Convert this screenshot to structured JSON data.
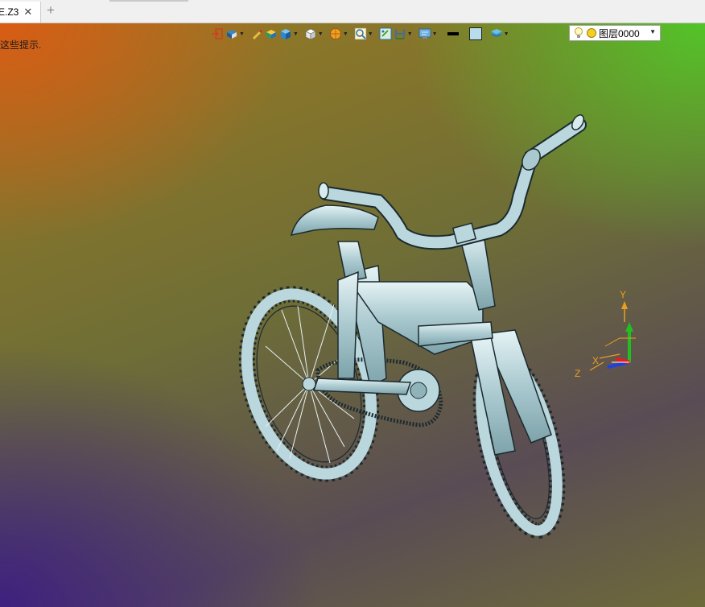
{
  "tab": {
    "title": "E.Z3",
    "close_glyph": "✕"
  },
  "new_tab_glyph": "+",
  "hint": "这些提示.",
  "toolbar": {
    "items": [
      {
        "icon": "exit-icon",
        "dropdown": false
      },
      {
        "icon": "view-mode-icon",
        "dropdown": true
      },
      {
        "icon": "pen-icon",
        "dropdown": false
      },
      {
        "icon": "shaded-solid-icon",
        "dropdown": false
      },
      {
        "icon": "cube-blue-icon",
        "dropdown": true
      },
      {
        "icon": "cube-white-icon",
        "dropdown": true
      },
      {
        "icon": "orange-sphere-icon",
        "dropdown": true
      },
      {
        "icon": "zoom-icon",
        "dropdown": true
      },
      {
        "icon": "fit-view-icon",
        "dropdown": false
      },
      {
        "icon": "dimension-icon",
        "dropdown": true
      },
      {
        "icon": "display-icon",
        "dropdown": true
      },
      {
        "icon": "line-color-icon",
        "dropdown": false
      },
      {
        "icon": "fill-color-icon",
        "dropdown": false
      },
      {
        "icon": "layer-stack-icon",
        "dropdown": true
      }
    ]
  },
  "layer": {
    "name": "图层0000",
    "dropdown_glyph": "▼"
  },
  "axes": {
    "x": "X",
    "y": "Y",
    "z": "Z"
  },
  "colors": {
    "part": "#b9d7dc",
    "edge": "#1c2a30",
    "axis_x": "#e02020",
    "axis_y": "#20c020",
    "axis_z": "#2040e0",
    "axis_label": "#e8a020"
  }
}
